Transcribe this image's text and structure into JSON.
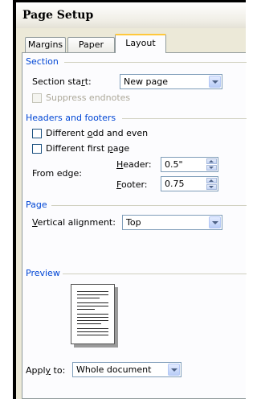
{
  "dialog": {
    "title": "Page Setup"
  },
  "tabs": [
    {
      "label": "Margins"
    },
    {
      "label": "Paper"
    },
    {
      "label": "Layout"
    }
  ],
  "section": {
    "heading": "Section",
    "start_label_pre": "Section sta",
    "start_label_ul": "r",
    "start_label_post": "t:",
    "start_value": "New page",
    "suppress_label": "Suppress endnotes"
  },
  "headers": {
    "heading": "Headers and footers",
    "odd_even_pre": "Different ",
    "odd_even_ul": "o",
    "odd_even_post": "dd and even",
    "first_page_pre": "Different first ",
    "first_page_ul": "p",
    "first_page_post": "age",
    "from_edge_label": "From edge:",
    "header_ul": "H",
    "header_rest": "eader:",
    "header_value": "0.5\"",
    "footer_ul": "F",
    "footer_rest": "ooter:",
    "footer_value": "0.75"
  },
  "page": {
    "heading": "Page",
    "valign_ul": "V",
    "valign_rest": "ertical alignment:",
    "valign_value": "Top"
  },
  "preview": {
    "heading": "Preview"
  },
  "apply": {
    "label_pre": "Appl",
    "label_ul": "y",
    "label_post": " to:",
    "value": "Whole document"
  }
}
